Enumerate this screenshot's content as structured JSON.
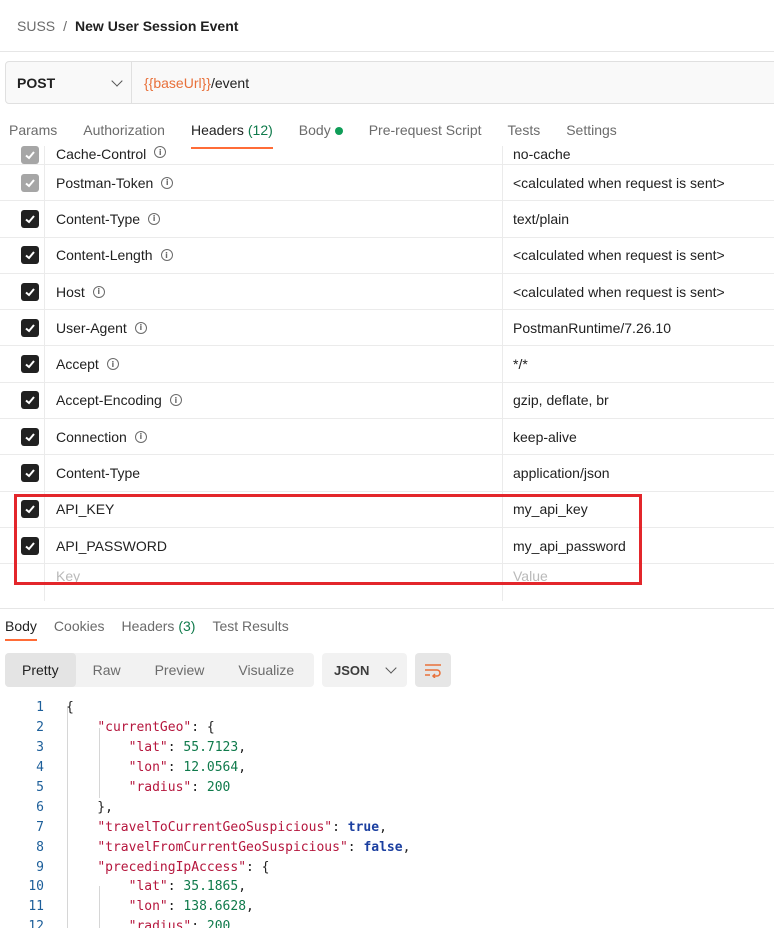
{
  "breadcrumb": {
    "collection": "SUSS",
    "separator": "/",
    "request": "New User Session Event"
  },
  "request": {
    "method": "POST",
    "url_var": "{{baseUrl}}",
    "url_path": "/event"
  },
  "request_tabs": [
    {
      "label": "Params"
    },
    {
      "label": "Authorization"
    },
    {
      "label": "Headers",
      "count": "(12)"
    },
    {
      "label": "Body"
    },
    {
      "label": "Pre-request Script"
    },
    {
      "label": "Tests"
    },
    {
      "label": "Settings"
    }
  ],
  "headers": [
    {
      "key": "Cache-Control",
      "value": "no-cache",
      "auto": true
    },
    {
      "key": "Postman-Token",
      "value": "<calculated when request is sent>",
      "auto": true
    },
    {
      "key": "Content-Type",
      "value": "text/plain",
      "auto": false
    },
    {
      "key": "Content-Length",
      "value": "<calculated when request is sent>",
      "auto": false
    },
    {
      "key": "Host",
      "value": "<calculated when request is sent>",
      "auto": false
    },
    {
      "key": "User-Agent",
      "value": "PostmanRuntime/7.26.10",
      "auto": false
    },
    {
      "key": "Accept",
      "value": "*/*",
      "auto": false
    },
    {
      "key": "Accept-Encoding",
      "value": "gzip, deflate, br",
      "auto": false
    },
    {
      "key": "Connection",
      "value": "keep-alive",
      "auto": false
    },
    {
      "key": "Content-Type",
      "value": "application/json",
      "auto": false
    },
    {
      "key": "API_KEY",
      "value": "my_api_key",
      "auto": false
    },
    {
      "key": "API_PASSWORD",
      "value": "my_api_password",
      "auto": false
    }
  ],
  "new_header": {
    "key_placeholder": "Key",
    "value_placeholder": "Value"
  },
  "response_tabs": [
    {
      "label": "Body"
    },
    {
      "label": "Cookies"
    },
    {
      "label": "Headers",
      "count": "(3)"
    },
    {
      "label": "Test Results"
    }
  ],
  "view_modes": [
    "Pretty",
    "Raw",
    "Preview",
    "Visualize"
  ],
  "format": "JSON",
  "code_lines": [
    "1",
    "2",
    "3",
    "4",
    "5",
    "6",
    "7",
    "8",
    "9",
    "10",
    "11",
    "12"
  ],
  "body_json": {
    "currentGeo": "currentGeo",
    "lat1": "55.7123",
    "lon1": "12.0564",
    "radius1": "200",
    "travelTo": "travelToCurrentGeoSuspicious",
    "travelToVal": "true",
    "travelFrom": "travelFromCurrentGeoSuspicious",
    "travelFromVal": "false",
    "preceding": "precedingIpAccess",
    "lat2": "35.1865",
    "lon2": "138.6628",
    "radius2": "200"
  },
  "colors": {
    "accent": "#ff6c37",
    "highlight": "#e3262b",
    "success": "#0f7a4b"
  }
}
